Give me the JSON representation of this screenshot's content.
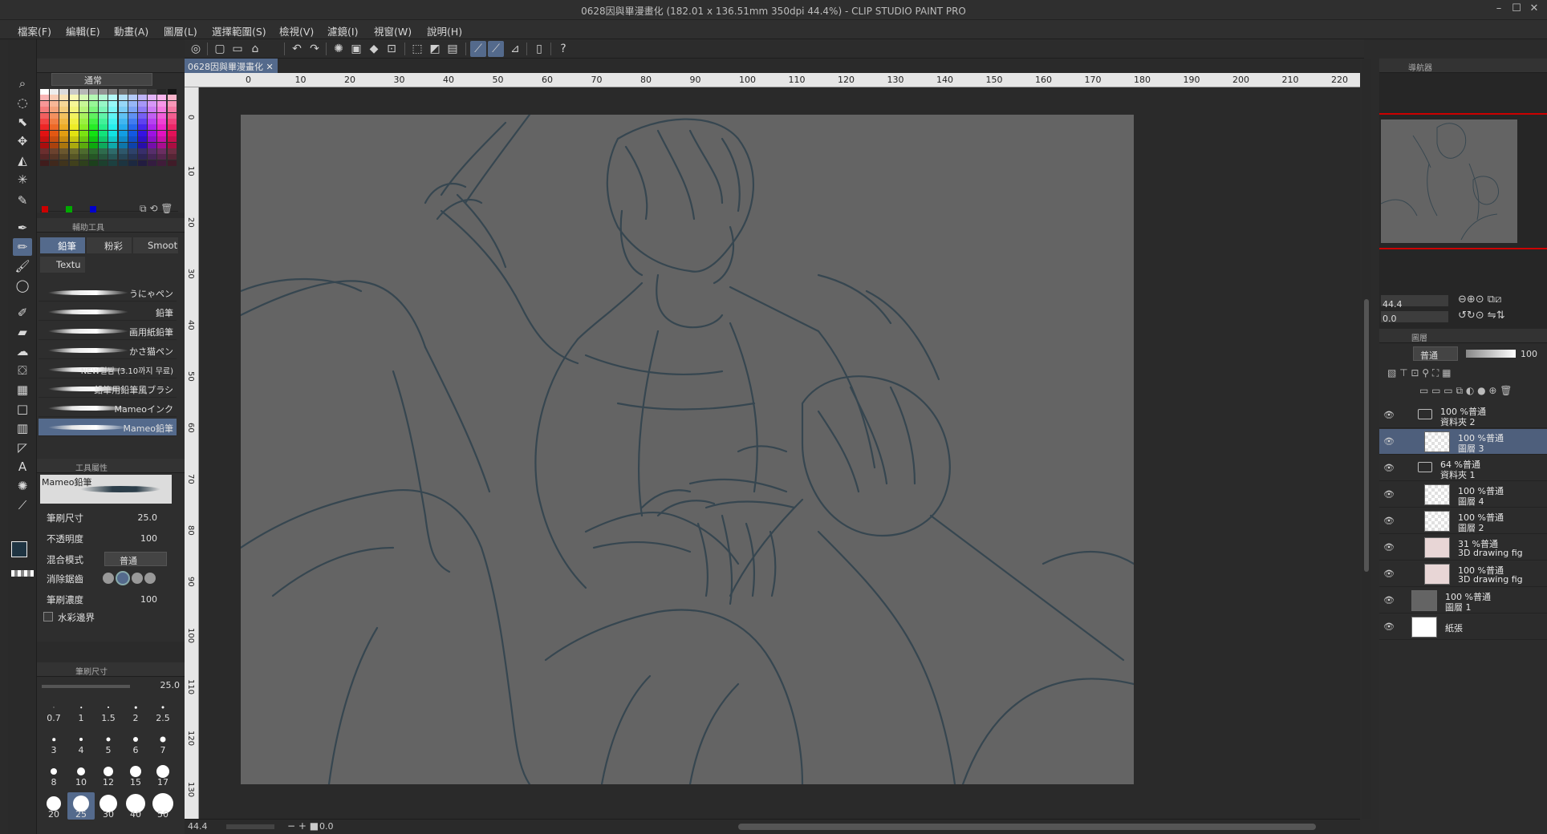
{
  "window": {
    "title": "0628因與畢漫畫化 (182.01 x 136.51mm 350dpi 44.4%)  - CLIP STUDIO PAINT PRO"
  },
  "menu": [
    "檔案(F)",
    "編輯(E)",
    "動畫(A)",
    "圖層(L)",
    "選擇範圍(S)",
    "檢視(V)",
    "濾鏡(I)",
    "視窗(W)",
    "說明(H)"
  ],
  "colorset": {
    "blend_mode": "通常"
  },
  "subtool_tabs": {
    "header": "輔助工具",
    "tabs": [
      "鉛筆",
      "粉彩",
      "Smoot",
      "Textu"
    ]
  },
  "brushes": [
    {
      "name": "うにゃペン"
    },
    {
      "name": "鉛筆"
    },
    {
      "name": "画用紙鉛筆"
    },
    {
      "name": "かさ猫ペン"
    },
    {
      "name": "NEW걸쌈 (3.10까지 무료)"
    },
    {
      "name": "鉛筆用鉛筆風ブラシ"
    },
    {
      "name": "Mameoインク"
    },
    {
      "name": "Mameo鉛筆"
    }
  ],
  "tool_property": {
    "header": "工具屬性",
    "brush_name": "Mameo鉛筆",
    "brush_size_label": "筆刷尺寸",
    "brush_size_value": "25.0",
    "opacity_label": "不透明度",
    "opacity_value": "100",
    "blend_label": "混合模式",
    "blend_value": "普通",
    "antialias_label": "消除鋸齒",
    "density_label": "筆刷濃度",
    "density_value": "100",
    "watercolor_label": "水彩邊界"
  },
  "brush_size_panel": {
    "header": "筆刷尺寸",
    "value": "25.0",
    "sizes": [
      "0.7",
      "1",
      "1.5",
      "2",
      "2.5",
      "3",
      "4",
      "5",
      "6",
      "7",
      "8",
      "10",
      "12",
      "15",
      "17",
      "20",
      "25",
      "30",
      "40",
      "50"
    ],
    "selected": "25"
  },
  "document": {
    "tab_label": "0628因與畢漫畫化",
    "ruler_labels": [
      "0",
      "10",
      "20",
      "30",
      "40",
      "50",
      "60",
      "70",
      "80",
      "90",
      "100",
      "110",
      "120",
      "130",
      "140",
      "150",
      "160",
      "170",
      "180",
      "190",
      "200",
      "210",
      "220"
    ],
    "vruler_labels": [
      "0",
      "10",
      "20",
      "30",
      "40",
      "50",
      "60",
      "70",
      "80",
      "90",
      "100",
      "110",
      "120",
      "130"
    ]
  },
  "status": {
    "zoom": "44.4",
    "angle": "0.0"
  },
  "navigator": {
    "header": "導航器",
    "zoom": "44.4",
    "rotation": "0.0"
  },
  "layers_panel": {
    "header": "圖層",
    "blend_mode": "普通",
    "opacity": "100"
  },
  "layers": [
    {
      "line1": "100 %普通",
      "line2": "資料夾 2",
      "type": "folder"
    },
    {
      "line1": "100 %普通",
      "line2": "圖層 3",
      "type": "raster",
      "selected": true
    },
    {
      "line1": "64 %普通",
      "line2": "資料夾 1",
      "type": "folder"
    },
    {
      "line1": "100 %普通",
      "line2": "圖層 4",
      "type": "raster"
    },
    {
      "line1": "100 %普通",
      "line2": "圖層 2",
      "type": "raster"
    },
    {
      "line1": "31 %普通",
      "line2": "3D drawing fig",
      "type": "3d"
    },
    {
      "line1": "100 %普通",
      "line2": "3D drawing fig",
      "type": "3d"
    },
    {
      "line1": "100 %普通",
      "line2": "圖層 1",
      "type": "gray"
    },
    {
      "line1": "",
      "line2": "紙張",
      "type": "paper"
    }
  ],
  "colors": {
    "accent": "#546a8c",
    "canvas": "#646464",
    "sketch_line": "#34454f"
  }
}
